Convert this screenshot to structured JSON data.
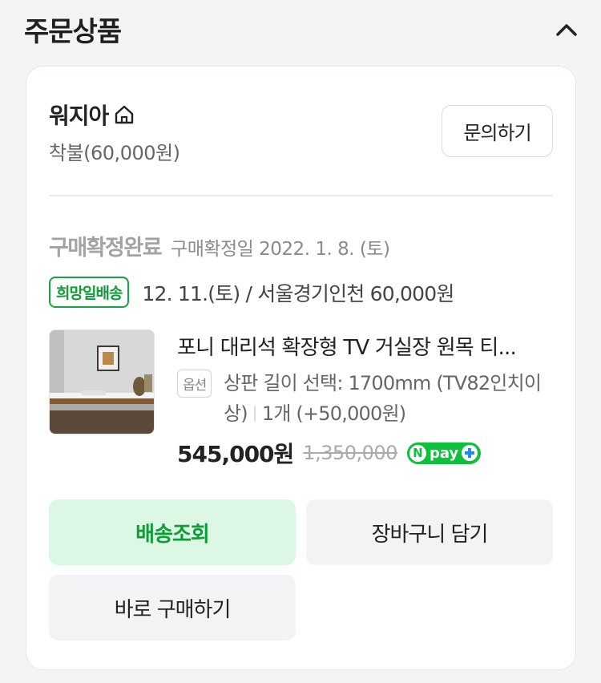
{
  "header": {
    "title": "주문상품"
  },
  "seller": {
    "name": "워지아",
    "shipping_fee": "착불(60,000원)",
    "inquiry_label": "문의하기"
  },
  "order": {
    "status": "구매확정완료",
    "confirm_date": "구매확정일 2022. 1. 8. (토)",
    "delivery_badge": "희망일배송",
    "delivery_info": "12. 11.(토) / 서울경기인천 60,000원"
  },
  "product": {
    "name": "포니 대리석 확장형 TV 거실장 원목 티...",
    "option_badge": "옵션",
    "option_text": "상판 길이 선택: 1700mm (TV82인치이상)",
    "quantity_text": "1개 (+50,000원)",
    "price": "545,000원",
    "original_price": "1,350,000",
    "npay_letter": "N",
    "npay_text": "pay"
  },
  "actions": {
    "track_label": "배송조회",
    "cart_label": "장바구니 담기",
    "buy_label": "바로 구매하기"
  }
}
